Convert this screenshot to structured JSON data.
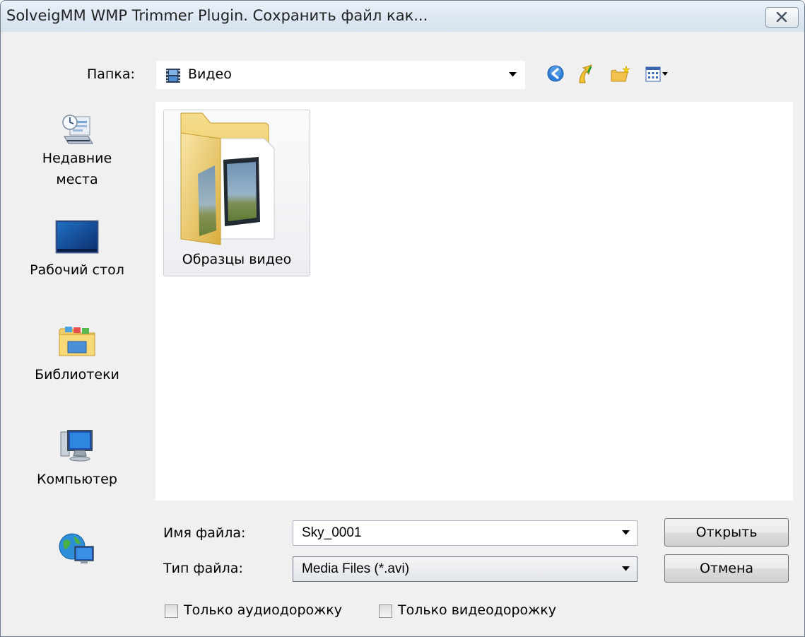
{
  "window": {
    "title": "SolveigMM WMP Trimmer Plugin. Сохранить файл как..."
  },
  "location": {
    "label": "Папка:",
    "value": "Видео"
  },
  "toolbar_icons": [
    "back-icon",
    "up-folder-icon",
    "new-folder-icon",
    "view-menu-icon"
  ],
  "places": [
    {
      "label_line1": "Недавние",
      "label_line2": "места",
      "icon": "recent-places-icon"
    },
    {
      "label_line1": "Рабочий стол",
      "icon": "desktop-icon"
    },
    {
      "label_line1": "Библиотеки",
      "icon": "libraries-icon"
    },
    {
      "label_line1": "Компьютер",
      "icon": "computer-icon"
    },
    {
      "icon": "network-icon"
    }
  ],
  "files": [
    {
      "name": "Образцы видео",
      "icon": "video-folder-icon"
    }
  ],
  "filename": {
    "label": "Имя файла:",
    "value": "Sky_0001"
  },
  "filetype": {
    "label": "Тип файла:",
    "value": "Media Files (*.avi)"
  },
  "buttons": {
    "open": "Открыть",
    "cancel": "Отмена"
  },
  "options": {
    "audio_only": "Только аудиодорожку",
    "video_only": "Только видеодорожку"
  }
}
